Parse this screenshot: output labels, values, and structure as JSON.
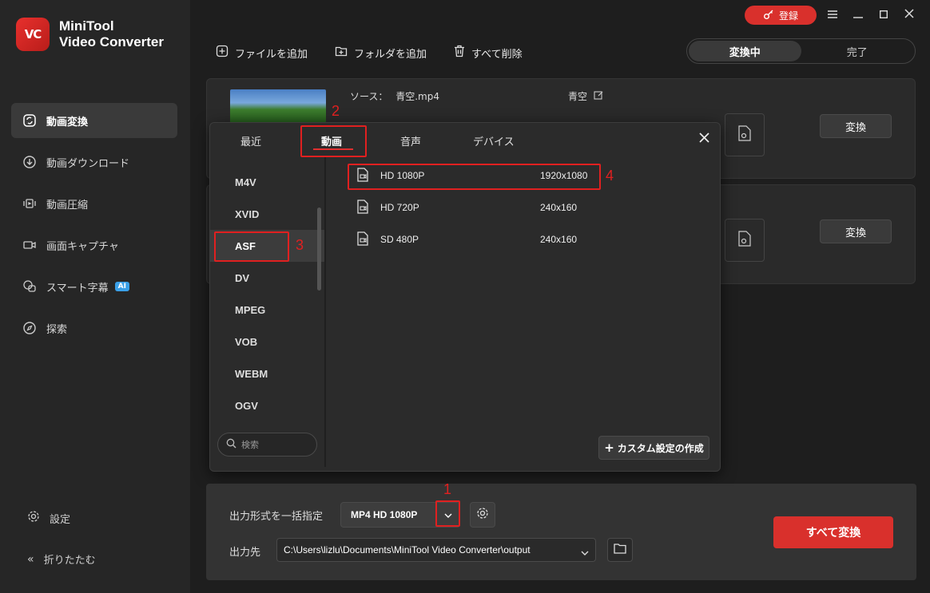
{
  "app": {
    "name_line1": "MiniTool",
    "name_line2": "Video Converter",
    "logo_text": "VC"
  },
  "titlebar": {
    "register_label": "登録"
  },
  "sidebar": {
    "items": [
      {
        "label": "動画変換",
        "icon": "convert-icon",
        "active": true
      },
      {
        "label": "動画ダウンロード",
        "icon": "download-icon"
      },
      {
        "label": "動画圧縮",
        "icon": "compress-icon"
      },
      {
        "label": "画面キャプチャ",
        "icon": "camera-icon"
      },
      {
        "label": "スマート字幕",
        "icon": "subtitle-icon",
        "badge": "AI"
      },
      {
        "label": "探索",
        "icon": "compass-icon"
      }
    ],
    "settings_label": "設定",
    "collapse_label": "折りたたむ"
  },
  "toolbar": {
    "add_file": "ファイルを追加",
    "add_folder": "フォルダを追加",
    "delete_all": "すべて削除"
  },
  "status_tabs": {
    "converting": "変換中",
    "done": "完了"
  },
  "file": {
    "source_label": "ソース：",
    "source_name": "青空.mp4",
    "output_name": "青空",
    "convert_label": "変換"
  },
  "popup": {
    "tabs": [
      "最近",
      "動画",
      "音声",
      "デバイス"
    ],
    "active_tab": "動画",
    "formats": [
      "M4V",
      "XVID",
      "ASF",
      "DV",
      "MPEG",
      "VOB",
      "WEBM",
      "OGV"
    ],
    "selected_format": "ASF",
    "search_placeholder": "検索",
    "presets": [
      {
        "name": "HD 1080P",
        "resolution": "1920x1080"
      },
      {
        "name": "HD 720P",
        "resolution": "240x160"
      },
      {
        "name": "SD 480P",
        "resolution": "240x160"
      }
    ],
    "custom_label": "カスタム設定の作成"
  },
  "bottom": {
    "format_label": "出力形式を一括指定",
    "format_value": "MP4 HD 1080P",
    "output_label": "出力先",
    "output_path": "C:\\Users\\lizlu\\Documents\\MiniTool Video Converter\\output",
    "convert_all": "すべて変換"
  },
  "annotations": [
    "1",
    "2",
    "3",
    "4"
  ],
  "colors": {
    "accent": "#d9302c",
    "annotation": "#e02020",
    "background": "#1e1e1e",
    "sidebar": "#262626"
  }
}
